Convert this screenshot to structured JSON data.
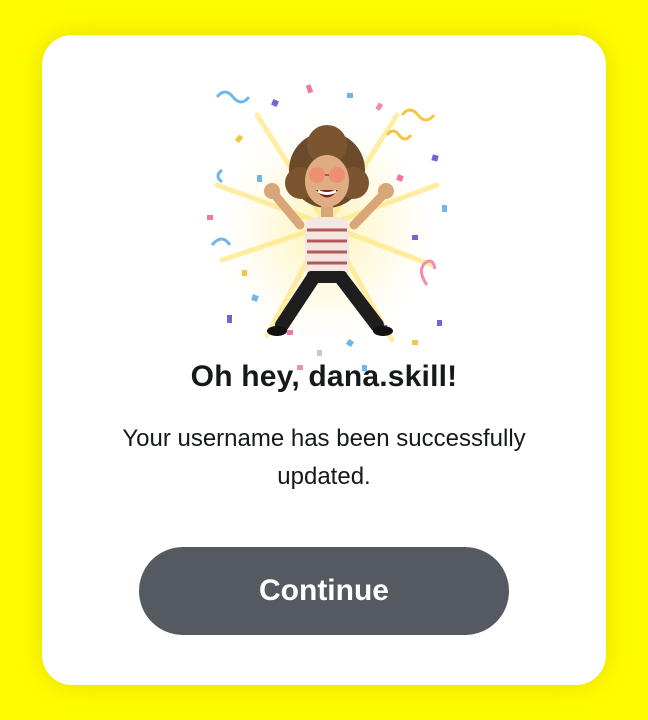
{
  "dialog": {
    "avatar": "bitmoji-celebration-avatar",
    "title": "Oh hey, dana.skill!",
    "message": "Your username has been successfully updated.",
    "continue_label": "Continue"
  },
  "colors": {
    "background": "#FFFC00",
    "card": "#FFFFFF",
    "button": "#555A60",
    "button_text": "#FFFFFF",
    "text": "#16191C"
  }
}
